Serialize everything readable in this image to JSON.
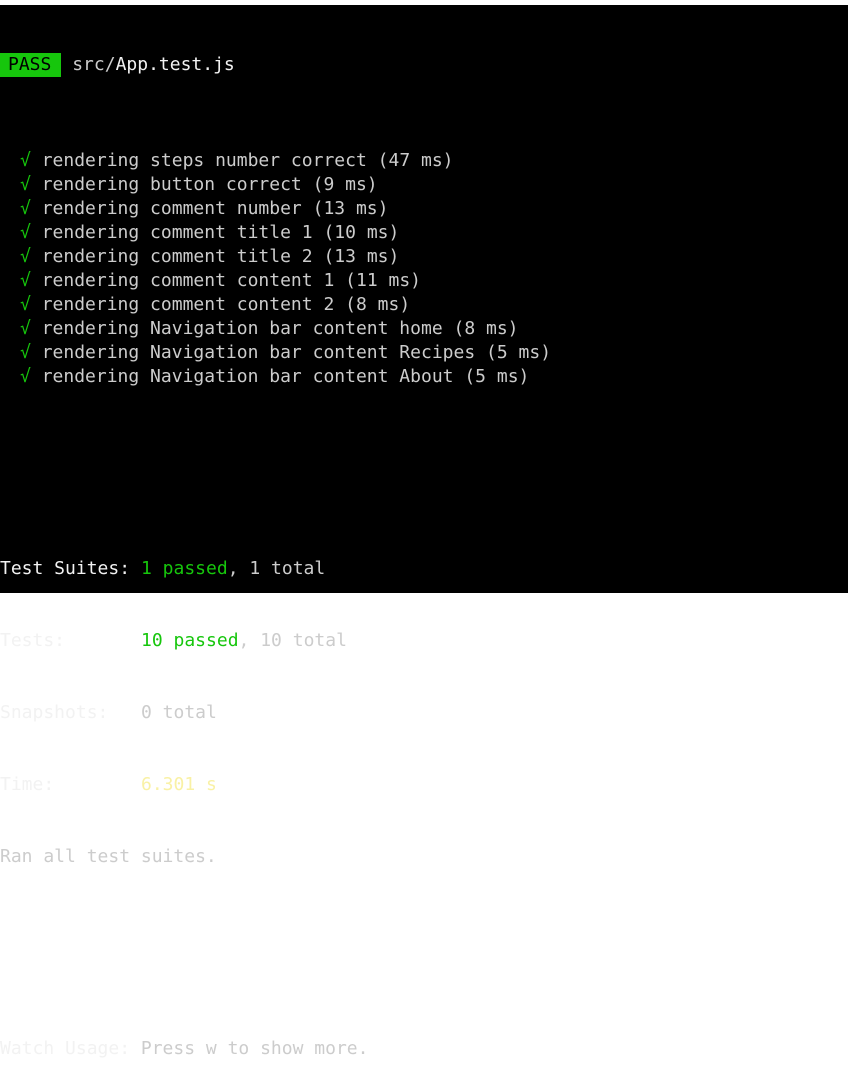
{
  "header": {
    "status": "PASS",
    "file_dir": "src/",
    "file_name": "App.test.js"
  },
  "tests": [
    {
      "check": "√",
      "name": "rendering steps number correct",
      "duration": "(47 ms)"
    },
    {
      "check": "√",
      "name": "rendering button correct",
      "duration": "(9 ms)"
    },
    {
      "check": "√",
      "name": "rendering comment number",
      "duration": "(13 ms)"
    },
    {
      "check": "√",
      "name": "rendering comment title 1",
      "duration": "(10 ms)"
    },
    {
      "check": "√",
      "name": "rendering comment title 2",
      "duration": "(13 ms)"
    },
    {
      "check": "√",
      "name": "rendering comment content 1",
      "duration": "(11 ms)"
    },
    {
      "check": "√",
      "name": "rendering comment content 2",
      "duration": "(8 ms)"
    },
    {
      "check": "√",
      "name": "rendering Navigation bar content home",
      "duration": "(8 ms)"
    },
    {
      "check": "√",
      "name": "rendering Navigation bar content Recipes",
      "duration": "(5 ms)"
    },
    {
      "check": "√",
      "name": "rendering Navigation bar content About",
      "duration": "(5 ms)"
    }
  ],
  "summary": {
    "suites_label": "Test Suites:",
    "suites_passed": "1 passed",
    "suites_rest": ", 1 total",
    "tests_label": "Tests:",
    "tests_passed": "10 passed",
    "tests_rest": ", 10 total",
    "snapshots_label": "Snapshots:",
    "snapshots_value": "0 total",
    "time_label": "Time:",
    "time_value": "6.301 s",
    "ran_all": "Ran all test suites."
  },
  "watch": {
    "label": "Watch Usage:",
    "text": " Press w to show more."
  },
  "colors": {
    "background": "#000000",
    "pass_badge": "#16c60c",
    "passed_text": "#16c60c",
    "time_text": "#f9f1a5",
    "default_text": "#cccccc"
  }
}
